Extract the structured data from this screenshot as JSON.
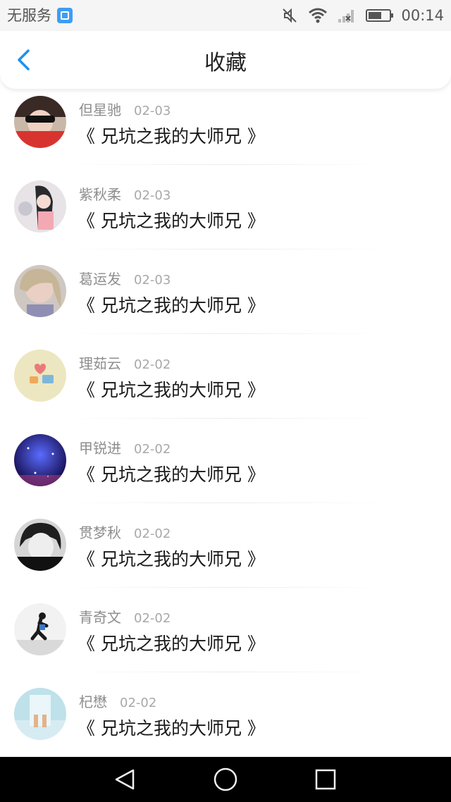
{
  "status_bar": {
    "carrier": "无服务",
    "time": "00:14",
    "icons": [
      "gallery-notification-icon",
      "mute-icon",
      "wifi-icon",
      "signal-icon",
      "battery-icon"
    ]
  },
  "header": {
    "title": "收藏",
    "back_icon": "chevron-left-icon"
  },
  "favorites": [
    {
      "author": "但星驰",
      "date": "02-03",
      "title": "《 兄坑之我的大师兄 》"
    },
    {
      "author": "紫秋柔",
      "date": "02-03",
      "title": "《 兄坑之我的大师兄 》"
    },
    {
      "author": "葛运发",
      "date": "02-03",
      "title": "《 兄坑之我的大师兄 》"
    },
    {
      "author": "理茹云",
      "date": "02-02",
      "title": "《 兄坑之我的大师兄 》"
    },
    {
      "author": "甲锐进",
      "date": "02-02",
      "title": "《 兄坑之我的大师兄 》"
    },
    {
      "author": "贯梦秋",
      "date": "02-02",
      "title": "《 兄坑之我的大师兄 》"
    },
    {
      "author": "青奇文",
      "date": "02-02",
      "title": "《 兄坑之我的大师兄 》"
    },
    {
      "author": "杞懋",
      "date": "02-02",
      "title": "《 兄坑之我的大师兄 》"
    }
  ],
  "nav_bar": {
    "icons": [
      "back-triangle-icon",
      "home-circle-icon",
      "recent-square-icon"
    ]
  },
  "colors": {
    "accent": "#1e8ff0",
    "author_text": "#8e8e8e",
    "date_text": "#a8a8a8",
    "title_text": "#1a1a1a",
    "status_bar_bg": "#f5f5f5",
    "nav_bar_bg": "#000000"
  }
}
